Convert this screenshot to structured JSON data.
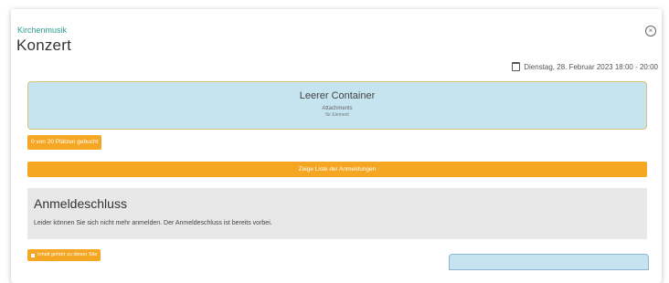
{
  "event": {
    "category": "Kirchenmusik",
    "title": "Konzert",
    "date": "Dienstag, 28. Februar 2023 18:00 - 20:00"
  },
  "container": {
    "title": "Leerer Container",
    "line1": "Attachments",
    "line2": "für Element"
  },
  "booking": {
    "status": "0 von 20 Plätzen gebucht",
    "list_button": "Zeige Liste der Anmeldungen"
  },
  "deadline": {
    "heading": "Anmeldeschluss",
    "text": "Leider können Sie sich nicht mehr anmelden. Der Anmeldeschluss ist bereits vorbei."
  },
  "footer": {
    "badge": "Inhalt gehört zu dieser Site"
  },
  "icons": {
    "close": "close-circle-icon",
    "calendar": "calendar-icon"
  },
  "colors": {
    "accent": "#f5a623",
    "teal": "#2a9d8f",
    "container_bg": "#c6e4ef",
    "deadline_bg": "#e8e8e8"
  }
}
